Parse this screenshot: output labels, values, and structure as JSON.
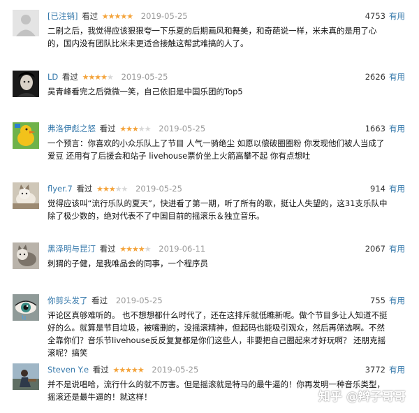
{
  "labels": {
    "seen": "看过",
    "useful": "有用"
  },
  "watermark": "知乎 @辫子哥哥",
  "reviews": [
    {
      "user": "[已注销]",
      "stars": "★★★★★",
      "stars_off": "",
      "date": "2019-05-25",
      "votes": "4753",
      "content": "二刷之后，我觉得应该狠狠夸一下乐夏的后期画风和舞美，和奇葩说一样，米未真的是用了心的，国内没有团队比米未更适合接触这帮武难搞的人了。",
      "avatar": "default-avatar-icon"
    },
    {
      "user": "LD",
      "stars": "★★★★",
      "stars_off": "★",
      "date": "2019-05-25",
      "votes": "2626",
      "content": "吴青峰看完之后微微一笑，自己依旧是中国乐团的Top5",
      "avatar": "dark-portrait"
    },
    {
      "user": "弗洛伊彪之怒",
      "stars": "★★★",
      "stars_off": "★★",
      "date": "2019-05-25",
      "votes": "1663",
      "content": "一个预言：你喜欢的小众乐队上了节目 人气一骑绝尘 如愿以偿破圈圈粉 你发现他们被人当成了爱豆 还用有了后援会和站子 livehouse票价坐上火箭高攀不起 你有点想吐",
      "avatar": "cartoon-duck"
    },
    {
      "user": "flyer.7",
      "stars": "★★★",
      "stars_off": "★★",
      "date": "2019-05-25",
      "votes": "914",
      "content": "觉得应该叫“流行乐队的夏天”，快进看了第一期，听了所有的歌，挺让人失望的，这31支乐队中除了极少数的，绝对代表不了中国目前的摇滚乐＆独立音乐。",
      "avatar": "cat-photo"
    },
    {
      "user": "黑泽明与昆汀",
      "stars": "★★★★",
      "stars_off": "★",
      "date": "2019-06-11",
      "votes": "2067",
      "content": "刺猬的子健，是我唯品会的同事，一个程序员",
      "avatar": "cat-photo-2"
    },
    {
      "user": "你剪头发了",
      "stars": "",
      "stars_off": "",
      "date": "2019-05-25",
      "votes": "755",
      "content": "评论区真够难听的。 也不想想都什么时代了，还在这排斥就低瞧新呢。做个节目多让人知道不挺好的么。就算是节目垃圾，被嘴删的，没摇滚精神，但起码也能吸引观众，然后再筛选啊。不然全靠你们？音乐节livehouse反反复复都是你们这些人，非要把自己圈起来才好玩啊？ 还朋克摇滚呢？搞笑",
      "avatar": "eye-photo"
    },
    {
      "user": "Steven Y.e",
      "stars": "★★★★★",
      "stars_off": "",
      "date": "2019-05-25",
      "votes": "3772",
      "content": "并不是说唱哈，流行什么的就不厉害。但是摇滚就是特马的最牛逼的！你再发明一种音乐类型，摇滚还是最牛逼的！就这样！",
      "avatar": "person-photo"
    }
  ]
}
